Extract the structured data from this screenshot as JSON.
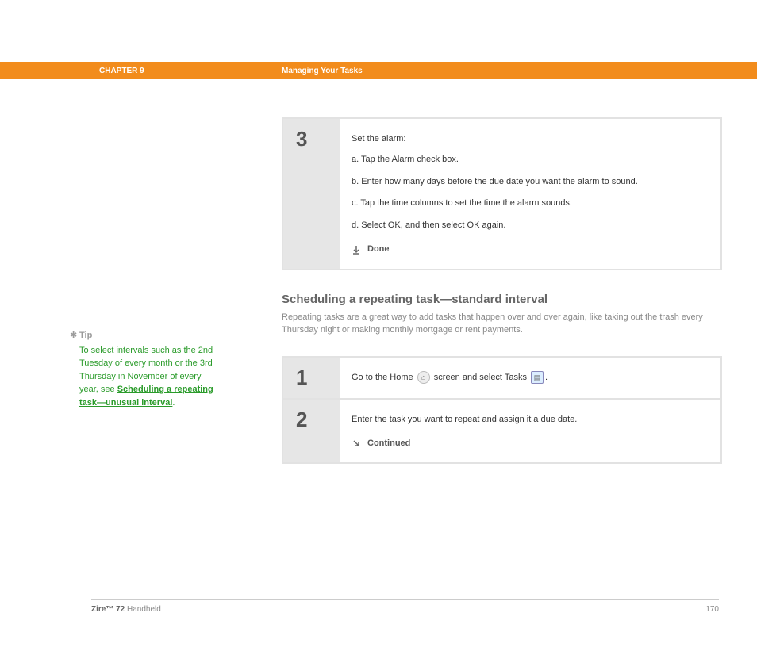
{
  "header": {
    "chapter": "CHAPTER 9",
    "title": "Managing Your Tasks"
  },
  "step3": {
    "num": "3",
    "intro": "Set the alarm:",
    "a": "a.  Tap the Alarm check box.",
    "b": "b.  Enter how many days before the due date you want the alarm to sound.",
    "c": "c.  Tap the time columns to set the time the alarm sounds.",
    "d": "d.  Select OK, and then select OK again.",
    "done": "Done"
  },
  "section": {
    "heading": "Scheduling a repeating task—standard interval",
    "desc": "Repeating tasks are a great way to add tasks that happen over and over again, like taking out the trash every Thursday night or making monthly mortgage or rent payments."
  },
  "tip": {
    "label": "Tip",
    "text": "To select intervals such as the 2nd Tuesday of every month or the 3rd Thursday in November of every year, see ",
    "link": "Scheduling a repeating task—unusual interval",
    "tail": "."
  },
  "step1": {
    "num": "1",
    "pre": "Go to the Home ",
    "mid": " screen and select Tasks ",
    "post": "."
  },
  "step2": {
    "num": "2",
    "text": "Enter the task you want to repeat and assign it a due date.",
    "continued": "Continued"
  },
  "footer": {
    "product_bold": "Zire™ 72",
    "product_rest": " Handheld",
    "page": "170"
  }
}
